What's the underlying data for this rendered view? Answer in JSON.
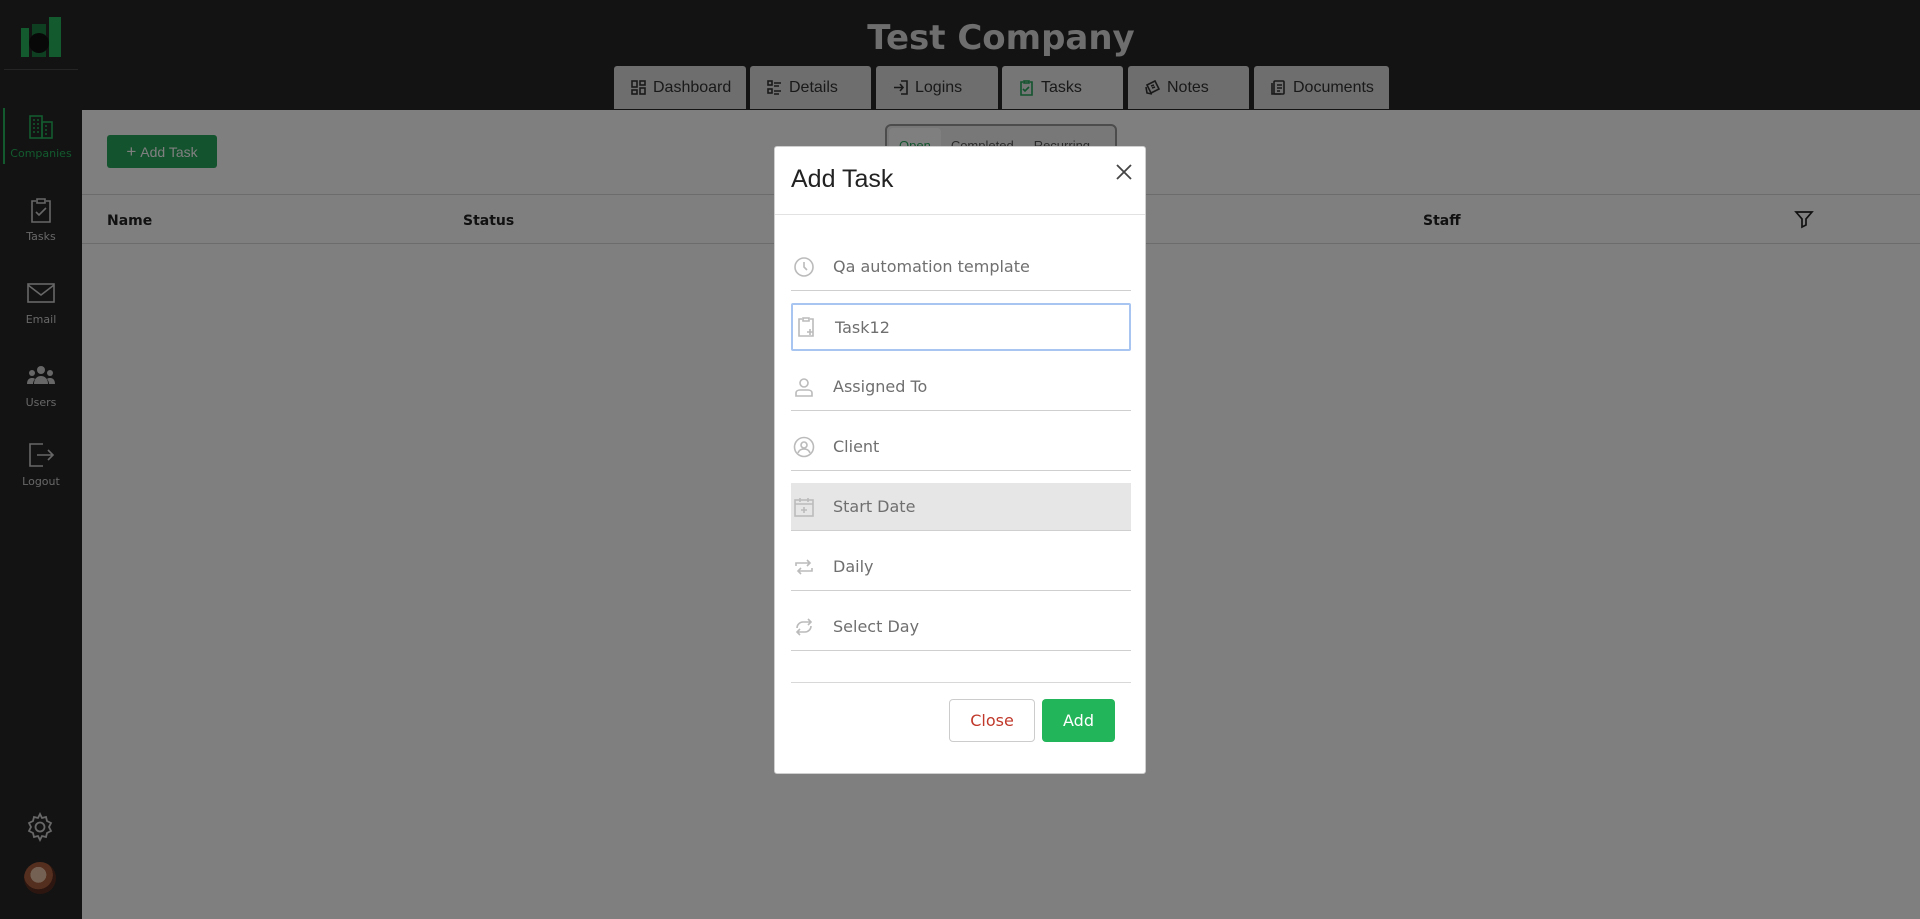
{
  "app": {
    "company_title": "Test Company"
  },
  "sidebar": {
    "items": [
      {
        "label": "Companies",
        "icon": "building-icon",
        "active": true
      },
      {
        "label": "Tasks",
        "icon": "clipboard-check-icon"
      },
      {
        "label": "Email",
        "icon": "envelope-icon"
      },
      {
        "label": "Users",
        "icon": "users-icon"
      },
      {
        "label": "Logout",
        "icon": "logout-icon"
      }
    ],
    "bottom": {
      "settings_icon": "gear-icon",
      "avatar": "user-avatar"
    }
  },
  "tabs": [
    {
      "label": "Dashboard",
      "icon": "grid-icon"
    },
    {
      "label": "Details",
      "icon": "list-icon"
    },
    {
      "label": "Logins",
      "icon": "login-icon"
    },
    {
      "label": "Tasks",
      "icon": "clipboard-check-icon",
      "active": true
    },
    {
      "label": "Notes",
      "icon": "note-icon"
    },
    {
      "label": "Documents",
      "icon": "document-icon"
    }
  ],
  "toolbar": {
    "add_task_label": "Add Task",
    "segments": [
      "Open",
      "Completed",
      "Recurring"
    ],
    "active_segment": "Open"
  },
  "table": {
    "columns": [
      "Name",
      "Status",
      "Staff"
    ]
  },
  "modal": {
    "title": "Add Task",
    "fields": [
      {
        "value": "Qa automation template",
        "icon": "clock-icon"
      },
      {
        "value": "Task12",
        "icon": "clipboard-plus-icon",
        "focused": true
      },
      {
        "value": "Assigned To",
        "icon": "user-icon"
      },
      {
        "value": "Client",
        "icon": "user-circle-icon"
      },
      {
        "value": "Start Date",
        "icon": "calendar-icon",
        "disabled": true
      },
      {
        "value": "Daily",
        "icon": "repeat-icon"
      },
      {
        "value": "Select Day",
        "icon": "cycle-icon"
      }
    ],
    "close_label": "Close",
    "add_label": "Add"
  },
  "colors": {
    "sidebar_bg": "#262626",
    "accent_green": "#26b55c",
    "close_red": "#c0392b",
    "focus_border": "#a7c5f0"
  }
}
